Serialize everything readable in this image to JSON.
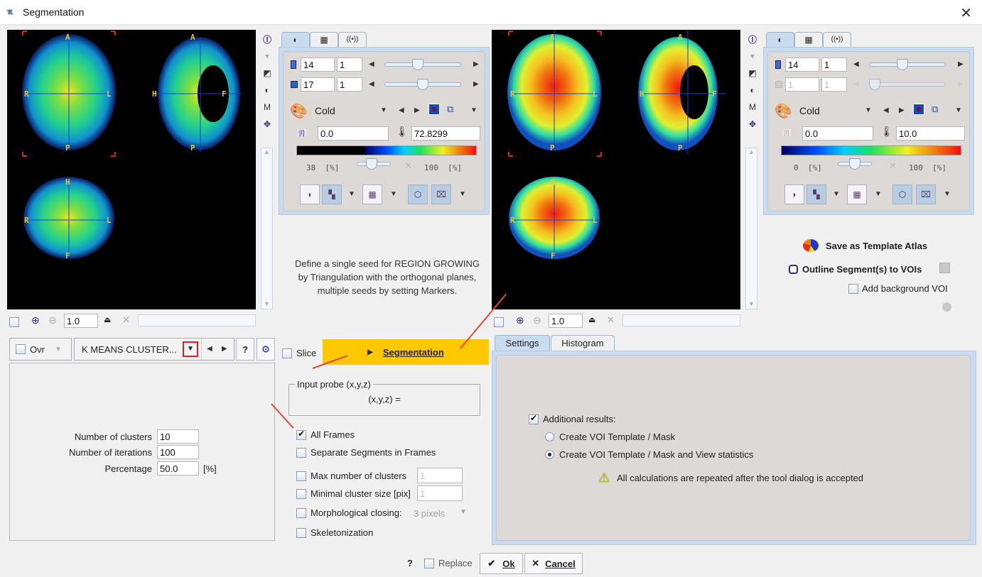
{
  "window": {
    "title": "Segmentation",
    "icon": "pmod-logo-icon",
    "close_label": "✕"
  },
  "left_viewer": {
    "orientation_labels": {
      "axial": [
        "A",
        "P",
        "R",
        "L"
      ],
      "sagittal": [
        "A",
        "P",
        "H",
        "F"
      ],
      "coronal": [
        "H",
        "F",
        "R",
        "L"
      ]
    },
    "zoom_value": "1.0"
  },
  "right_viewer": {
    "orientation_labels": {
      "axial": [
        "A",
        "P",
        "R",
        "L"
      ],
      "sagittal": [
        "A",
        "P",
        "H",
        "F"
      ],
      "coronal": [
        "H",
        "F",
        "R",
        "L"
      ]
    },
    "zoom_value": "1.0"
  },
  "left_control": {
    "tabs": [
      "◐",
      "▦",
      "((•))"
    ],
    "slice": {
      "value": "14",
      "step": "1",
      "position": 0.42
    },
    "frame": {
      "value": "17",
      "step": "1",
      "position": 0.5
    },
    "colortable": "Cold",
    "lower": "0.0",
    "upper": "72.8299",
    "lower_pct": "38",
    "upper_pct": "100",
    "pct_unit": "[%]",
    "colorbar_lower_fraction": 0.38
  },
  "right_control": {
    "tabs": [
      "◐",
      "▦",
      "((•))"
    ],
    "slice": {
      "value": "14",
      "step": "1",
      "position": 0.42
    },
    "frame": {
      "value": "1",
      "step": "1",
      "position": 0.0
    },
    "colortable": "Cold",
    "lower": "0.0",
    "upper": "10.0",
    "lower_pct": "0",
    "upper_pct": "100",
    "pct_unit": "[%]",
    "colorbar_lower_fraction": 0.0
  },
  "hint_text": [
    "Define a single seed for REGION GROWING",
    "by Triangulation with the orthogonal planes,",
    "multiple seeds by setting Markers."
  ],
  "right_actions": {
    "save_atlas": "Save as Template Atlas",
    "outline": "Outline Segment(s) to VOIs",
    "add_background": "Add background VOI",
    "add_background_checked": false
  },
  "method_bar": {
    "ovr_label": "Ovr",
    "method": "K MEANS CLUSTER...",
    "help": "?"
  },
  "params": [
    {
      "label": "Number of clusters",
      "value": "10",
      "unit": ""
    },
    {
      "label": "Number of iterations",
      "value": "100",
      "unit": ""
    },
    {
      "label": "Percentage",
      "value": "50.0",
      "unit": "[%]"
    }
  ],
  "middle": {
    "slice_label": "Slice",
    "slice_checked": false,
    "segmentation_button": "Segmentation",
    "segmentation_color": "#ffc800",
    "probe_title": "Input probe (x,y,z)",
    "probe_value": "(x,y,z) =",
    "options": [
      {
        "label": "All Frames",
        "checked": true
      },
      {
        "label": "Separate Segments in Frames",
        "checked": false
      },
      {
        "label": "Max number of clusters",
        "checked": false,
        "value": "1"
      },
      {
        "label": "Minimal cluster size [pix]",
        "checked": false,
        "value": "1"
      },
      {
        "label": "Morphological closing:",
        "checked": false,
        "select": "3 pixels"
      },
      {
        "label": "Skeletonization",
        "checked": false
      }
    ]
  },
  "result_tabs": {
    "tabs": [
      "Settings",
      "Histogram"
    ],
    "active": "Settings",
    "additional_results": "Additional results:",
    "additional_checked": true,
    "radio_options": [
      {
        "label": "Create VOI Template / Mask",
        "selected": false
      },
      {
        "label": "Create VOI Template / Mask and View statistics",
        "selected": true
      }
    ],
    "warning": "All calculations are repeated after the tool dialog is accepted"
  },
  "footer": {
    "help": "?",
    "replace_label": "Replace",
    "replace_checked": false,
    "ok": "Ok",
    "cancel": "Cancel"
  },
  "colors": {
    "annotation_arrow": "#e8433b",
    "highlight_box": "#e02020"
  }
}
